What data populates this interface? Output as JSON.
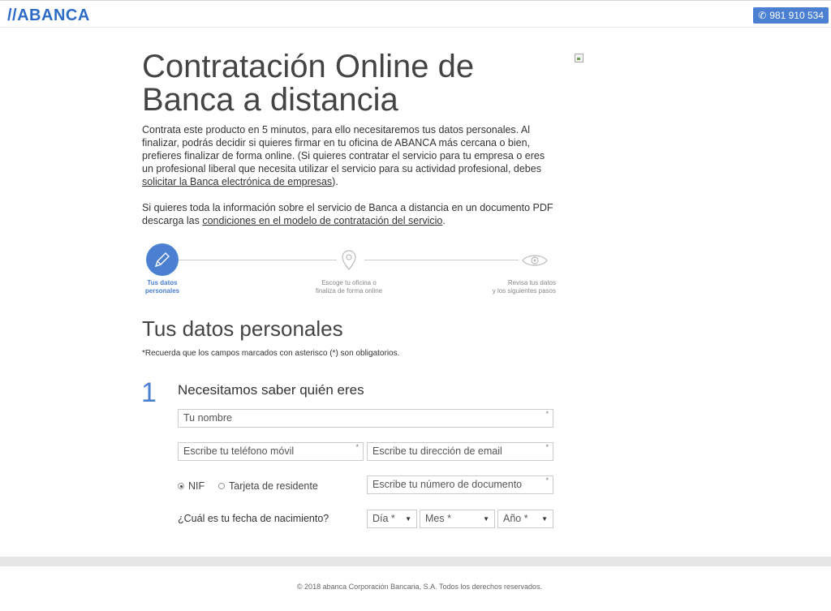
{
  "header": {
    "logo": "//ABANCA",
    "phone_label": "981 910 534"
  },
  "hero": {
    "title_line1": "Contratación Online de",
    "title_line2": "Banca a distancia"
  },
  "intro": {
    "p1_text": "Contrata este producto en 5 minutos, para ello necesitaremos tus datos personales. Al finalizar, podrás decidir si quieres firmar en tu oficina de ABANCA más cercana o bien, prefieres finalizar de forma online. (Si quieres contratar el servicio para tu empresa o eres un profesional liberal que necesita utilizar el servicio para su actividad profesional, debes ",
    "p1_link": "solicitar la Banca electrónica de empresas",
    "p1_end": ").",
    "p2_text": "Si quieres toda la información sobre el servicio de Banca a distancia en un documento PDF descarga las ",
    "p2_link": "condiciones en el modelo de contratación del servicio",
    "p2_end": "."
  },
  "steps": [
    {
      "line1": "Tus datos",
      "line2": "personales",
      "icon": "pencil-icon",
      "active": true
    },
    {
      "line1": "Escoge tu oficina o",
      "line2": "finaliza de forma online",
      "icon": "map-pin-icon",
      "active": false
    },
    {
      "line1": "Revisa tus datos",
      "line2": "y los siguientes pasos",
      "icon": "eye-icon",
      "active": false
    }
  ],
  "form": {
    "section_title": "Tus datos personales",
    "note": "*Recuerda que los campos marcados con asterisco (*) son obligatorios.",
    "step_number": "1",
    "subheading": "Necesitamos saber quién eres",
    "name_placeholder": "Tu nombre",
    "phone_placeholder": "Escribe tu teléfono móvil",
    "email_placeholder": "Escribe tu dirección de email",
    "doc_type_options": [
      "NIF",
      "Tarjeta de residente"
    ],
    "doc_type_selected": "NIF",
    "doc_placeholder": "Escribe tu número de documento",
    "required_mark": "*",
    "dob_label": "¿Cuál es tu fecha de nacimiento?",
    "day_select": "Día *",
    "month_select": "Mes *",
    "year_select": "Año *"
  },
  "footer": {
    "copyright": "© 2018 abanca Corporación Bancaria, S.A. Todos los derechos reservados."
  },
  "colors": {
    "accent": "#4a7fd1",
    "logo": "#2c6bc6"
  }
}
